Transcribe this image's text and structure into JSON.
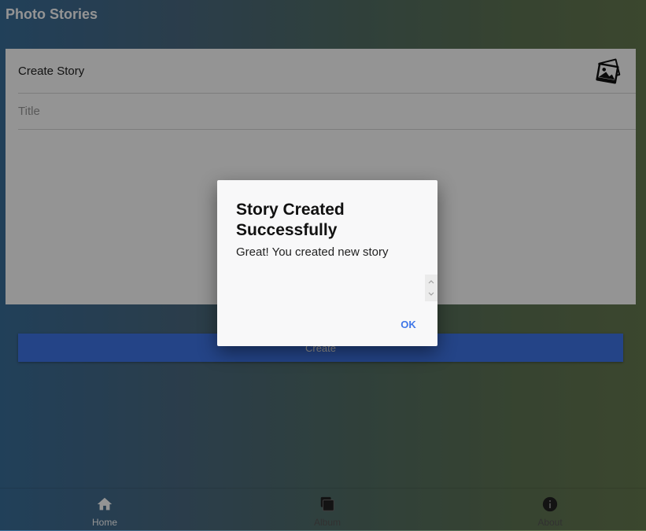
{
  "app": {
    "title": "Photo Stories"
  },
  "card": {
    "title": "Create Story",
    "icon": "photos-icon",
    "title_field": {
      "placeholder": "Title",
      "value": ""
    }
  },
  "create_button": {
    "label": "Create"
  },
  "bottom_nav": [
    {
      "label": "Home",
      "icon": "home-icon",
      "active": true
    },
    {
      "label": "Album",
      "icon": "album-icon",
      "active": false
    },
    {
      "label": "About",
      "icon": "info-icon",
      "active": false
    }
  ],
  "dialog": {
    "title": "Story Created Successfully",
    "message": "Great! You created new story",
    "ok_label": "OK"
  },
  "colors": {
    "accent": "#3f76e8",
    "card": "#ffffff",
    "dialog": "#f8f8f9"
  }
}
